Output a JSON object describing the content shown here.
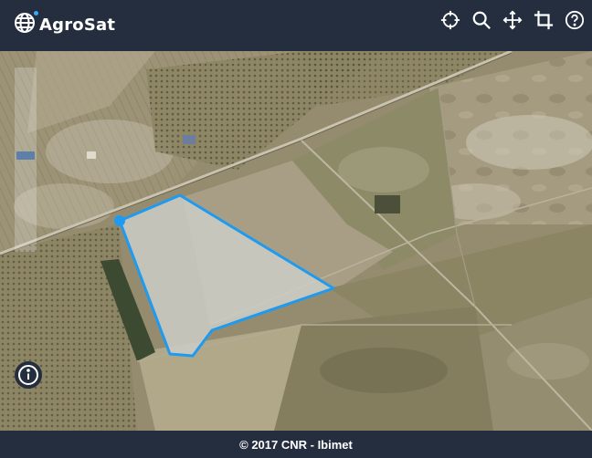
{
  "app": {
    "title": "AgroSat"
  },
  "toolbar": {
    "icons": [
      "locate-icon",
      "search-icon",
      "move-icon",
      "crop-icon",
      "help-icon"
    ]
  },
  "map": {
    "polygon_color": "#1e9bf0",
    "zoom_level": 0.55
  },
  "footer": {
    "text": "© 2017 CNR - Ibimet"
  }
}
